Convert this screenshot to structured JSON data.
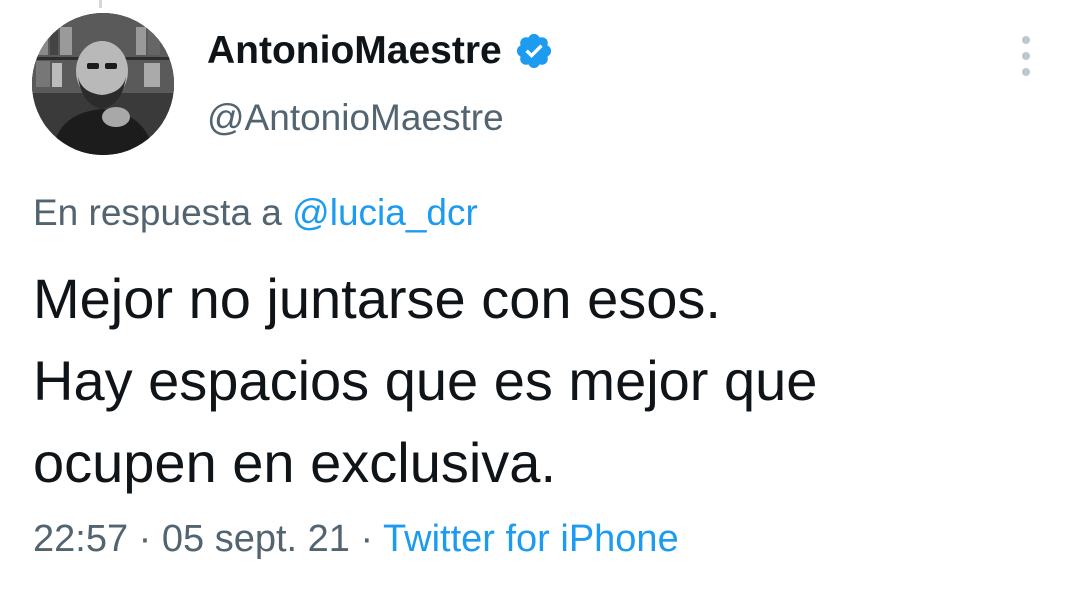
{
  "tweet": {
    "author": {
      "display_name": "AntonioMaestre",
      "handle": "@AntonioMaestre",
      "verified": true,
      "avatar_icon": "profile-photo"
    },
    "more_icon": "more-vertical-icon",
    "reply": {
      "prefix": "En respuesta a",
      "mention": "@lucia_dcr"
    },
    "text_lines": [
      "Mejor no juntarse con esos.",
      "Hay espacios que es mejor que",
      "ocupen en exclusiva."
    ],
    "meta": {
      "time": "22:57",
      "separator": "·",
      "date": "05 sept. 21",
      "source": "Twitter for iPhone"
    }
  },
  "colors": {
    "text_primary": "#0f1419",
    "text_secondary": "#536471",
    "accent": "#1d9bf0",
    "background": "#ffffff"
  }
}
